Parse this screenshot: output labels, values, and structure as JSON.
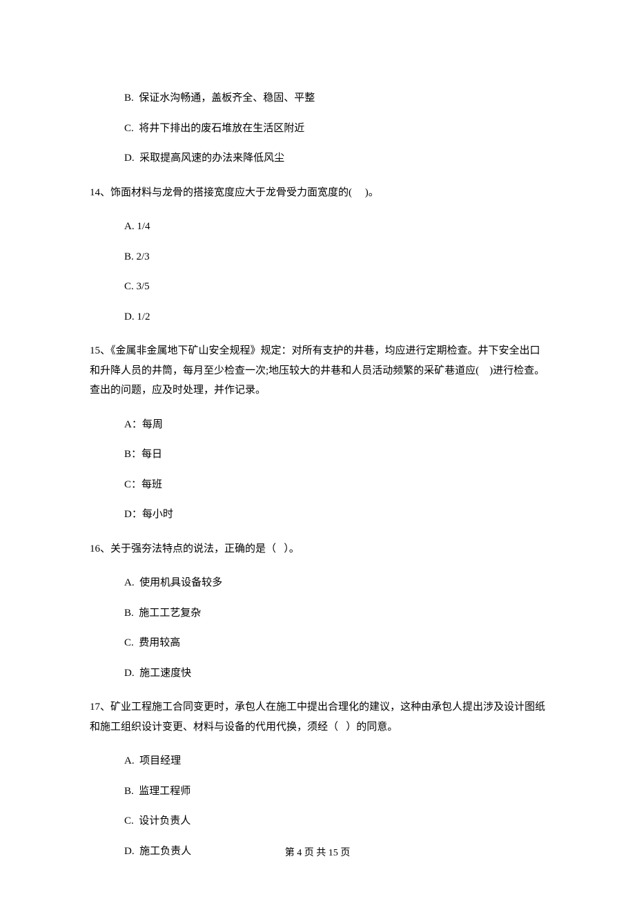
{
  "prev_options": {
    "b": "B.  保证水沟畅通，盖板齐全、稳固、平整",
    "c": "C.  将井下排出的废石堆放在生活区附近",
    "d": "D.  采取提高风速的办法来降低风尘"
  },
  "q14": {
    "stem": "14、饰面材料与龙骨的搭接宽度应大于龙骨受力面宽度的(     )。",
    "a": "A. 1/4",
    "b": "B. 2/3",
    "c": "C. 3/5",
    "d": "D. 1/2"
  },
  "q15": {
    "stem": "15、《金属非金属地下矿山安全规程》规定：对所有支护的井巷，均应进行定期检查。井下安全出口和升降人员的井筒，每月至少检查一次;地压较大的井巷和人员活动频繁的采矿巷道应(    )进行检查。查出的问题，应及时处理，并作记录。",
    "a": "A：每周",
    "b": "B：每日",
    "c": "C：每班",
    "d": "D：每小时"
  },
  "q16": {
    "stem": "16、关于强夯法特点的说法，正确的是（   ）。",
    "a": "A.  使用机具设备较多",
    "b": "B.  施工工艺复杂",
    "c": "C.  费用较高",
    "d": "D.  施工速度快"
  },
  "q17": {
    "stem": "17、矿业工程施工合同变更时，承包人在施工中提出合理化的建议，这种由承包人提出涉及设计图纸和施工组织设计变更、材料与设备的代用代换，须经（   ）的同意。",
    "a": "A.  项目经理",
    "b": "B.  监理工程师",
    "c": "C.  设计负责人",
    "d": "D.  施工负责人"
  },
  "footer": "第 4 页 共 15 页"
}
